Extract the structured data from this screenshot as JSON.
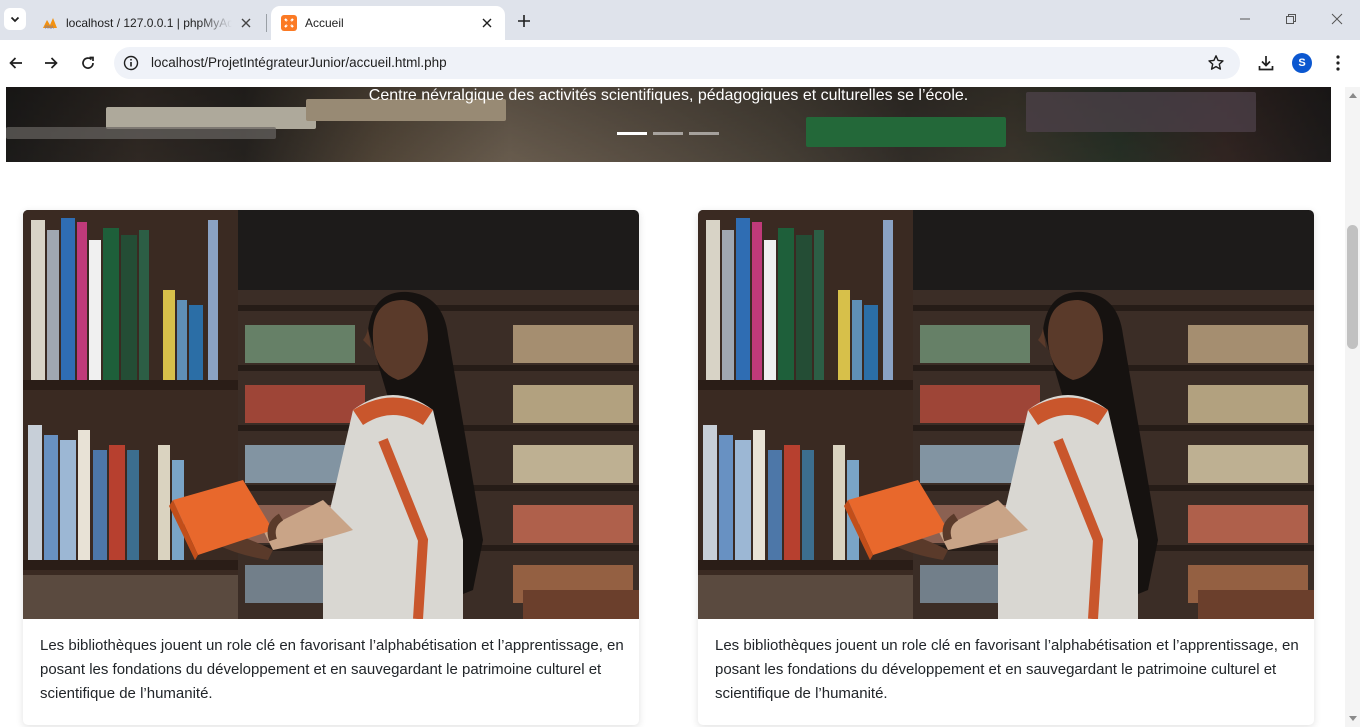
{
  "browser": {
    "tabs": [
      {
        "title": "localhost / 127.0.0.1 | phpMyAdmin",
        "active": false,
        "icon": "phpmyadmin-icon"
      },
      {
        "title": "Accueil",
        "active": true,
        "icon": "xampp-icon"
      }
    ],
    "url": "localhost/ProjetIntégrateurJunior/accueil.html.php",
    "profile_initial": "S"
  },
  "hero": {
    "caption": "Centre névralgique des activités scientifiques, pédagogiques et culturelles se l’école.",
    "slides": 3,
    "active_slide": 1
  },
  "cards": [
    {
      "text": "Les bibliothèques jouent un role clé en favorisant l’alphabétisation et l’apprentissage, en posant les fondations du développement et en sauvegardant le patrimoine culturel et scientifique de l’humanité.",
      "image": "student-library-photo"
    },
    {
      "text": "Les bibliothèques jouent un role clé en favorisant l’alphabétisation et l’apprentissage, en posant les fondations du développement et en sauvegardant le patrimoine culturel et scientifique de l’humanité.",
      "image": "student-library-photo"
    }
  ],
  "colors": {
    "tabstrip": "#dfe3eb",
    "omnibox": "#eff2f8",
    "accent": "#0b57d0",
    "card_text": "#212529",
    "book_orange": "#e8682c"
  }
}
